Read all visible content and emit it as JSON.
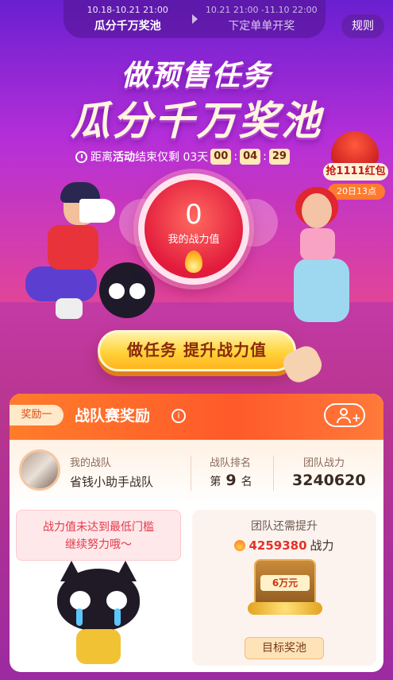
{
  "phases": [
    {
      "date": "10.18-10.21 21:00",
      "name": "瓜分千万奖池",
      "active": true
    },
    {
      "date": "10.21 21:00 -11.10 22:00",
      "name": "下定单单开奖",
      "active": false
    }
  ],
  "rules_label": "规则",
  "headline": {
    "line1": "做预售任务",
    "line2": "瓜分千万奖池"
  },
  "countdown": {
    "prefix": "距离",
    "highlight": "活动",
    "suffix": "结束仅剩 03天",
    "hours": "00",
    "minutes": "04",
    "seconds": "29"
  },
  "red_packet": {
    "label": "抢1111红包",
    "time": "20日13点"
  },
  "power": {
    "value": "0",
    "label": "我的战力值"
  },
  "cta_label": "做任务 提升战力值",
  "reward": {
    "tag": "奖励一",
    "title": "战队赛奖励",
    "info_icon": "i",
    "my_team_label": "我的战队",
    "team_name": "省钱小助手战队",
    "rank_label": "战队排名",
    "rank_prefix": "第",
    "rank_value": "9",
    "rank_suffix": "名",
    "team_power_label": "团队战力",
    "team_power_value": "3240620",
    "notice_line1": "战力值未达到最低门槛",
    "notice_line2": "继续努力哦～",
    "need_title": "团队还需提升",
    "need_value": "4259380",
    "need_unit": "战力",
    "chest_label": "6万元",
    "pool_button": "目标奖池"
  }
}
